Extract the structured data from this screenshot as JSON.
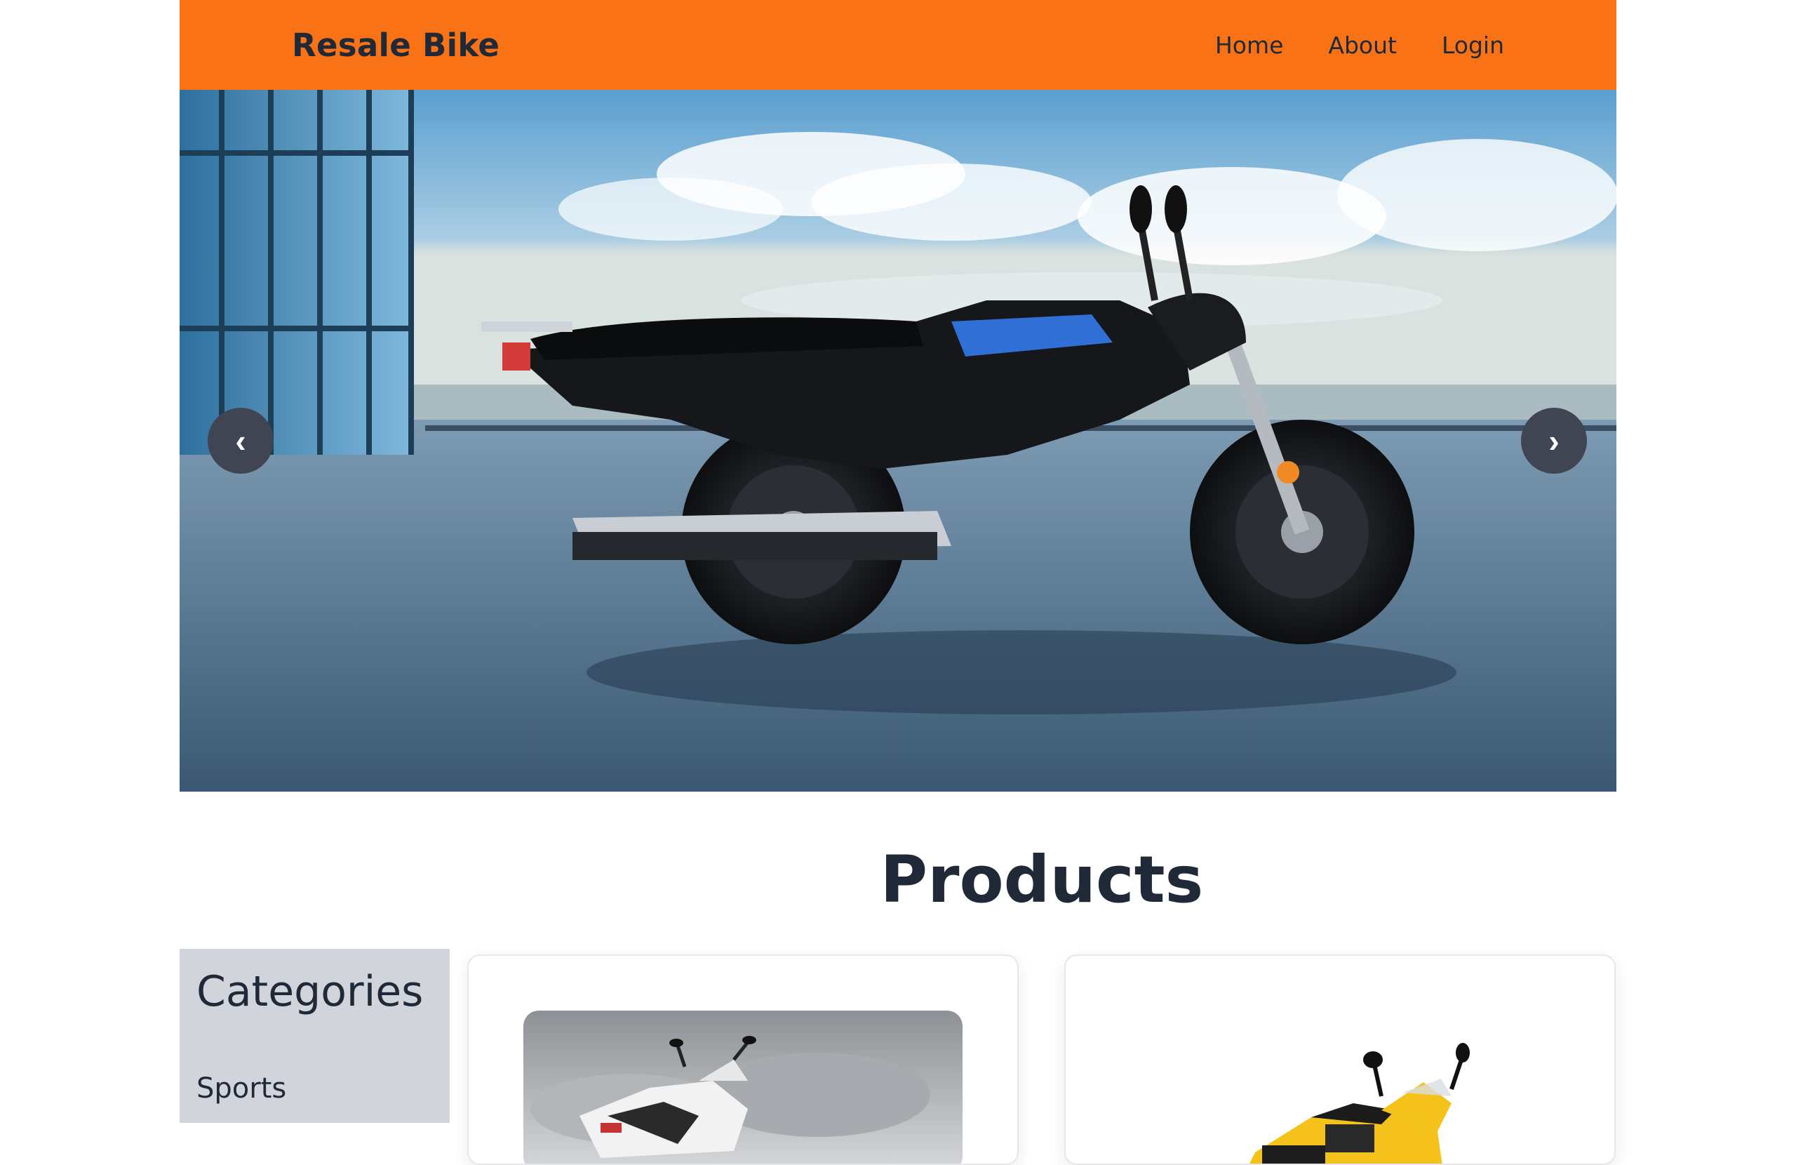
{
  "navbar": {
    "brand": "Resale Bike",
    "links": [
      {
        "label": "Home"
      },
      {
        "label": "About"
      },
      {
        "label": "Login"
      }
    ],
    "bg_color": "#f97316"
  },
  "hero": {
    "prev_glyph": "‹",
    "next_glyph": "›",
    "image": "motorcycle-photo"
  },
  "products": {
    "title": "Products",
    "categories_title": "Categories",
    "categories": [
      "Sports"
    ],
    "cards": [
      {
        "image": "white-sport-bike-photo"
      },
      {
        "image": "yellow-sport-bike-photo"
      }
    ]
  }
}
